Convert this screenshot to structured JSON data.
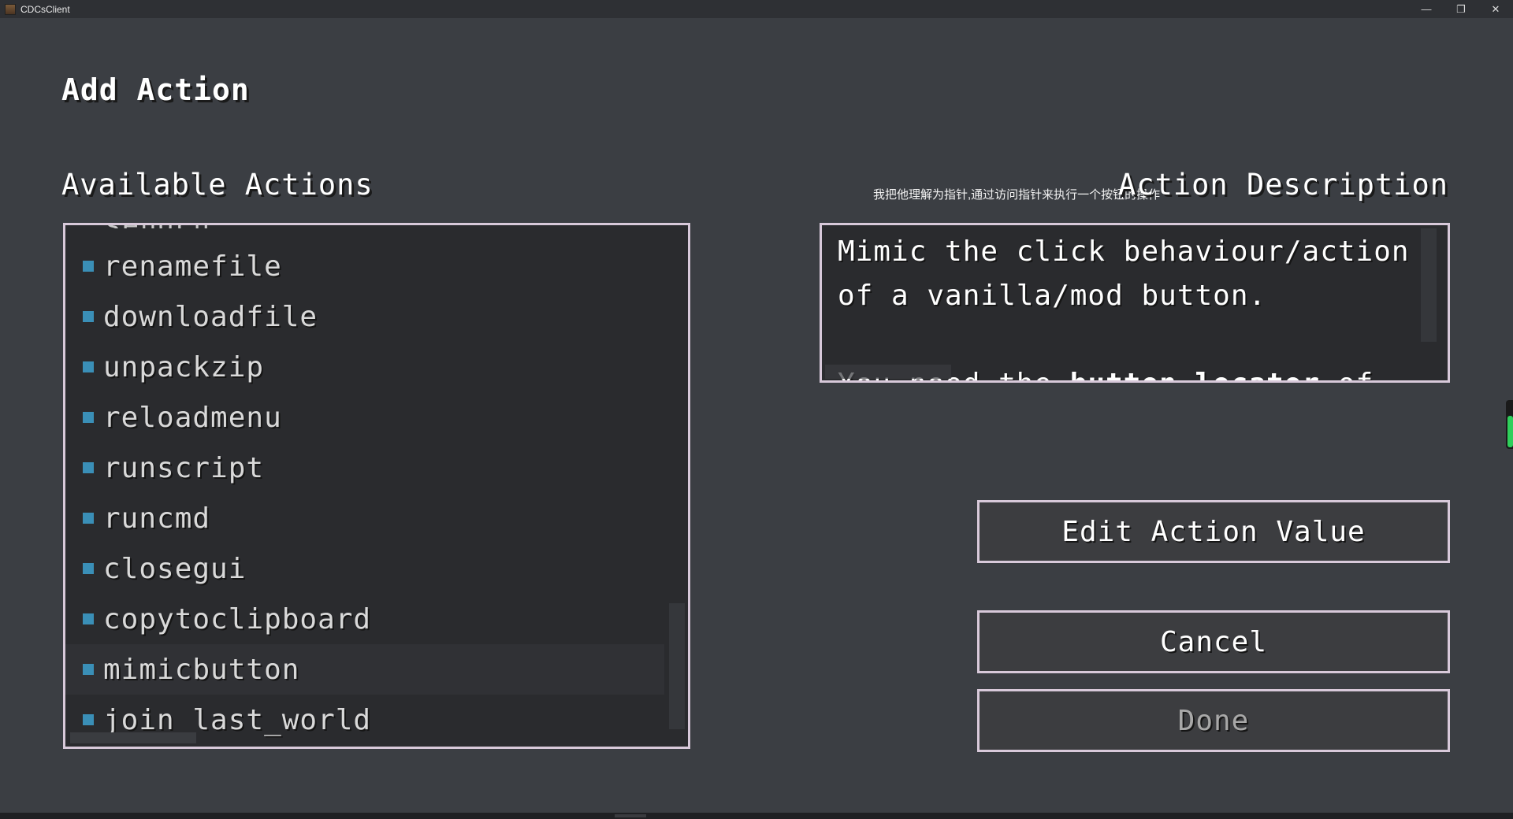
{
  "window": {
    "title": "CDCsClient",
    "minimize_glyph": "—",
    "restore_glyph": "❐",
    "close_glyph": "✕"
  },
  "page": {
    "title": "Add Action"
  },
  "annotation": "我把他理解为指针,通过访问指针来执行一个按钮的操作",
  "available_actions": {
    "heading": "Available Actions",
    "clipped_item": "sendchat",
    "items": [
      {
        "label": "renamefile"
      },
      {
        "label": "downloadfile"
      },
      {
        "label": "unpackzip"
      },
      {
        "label": "reloadmenu"
      },
      {
        "label": "runscript"
      },
      {
        "label": "runcmd"
      },
      {
        "label": "closegui"
      },
      {
        "label": "copytoclipboard"
      },
      {
        "label": "mimicbutton",
        "state": "hovered"
      },
      {
        "label": "join_last_world"
      }
    ],
    "bullet_color": "#3a8fb7"
  },
  "action_description": {
    "heading": "Action Description",
    "line1": "Mimic the click behaviour/action",
    "line2": "of a vanilla/mod button.",
    "line3_prefix": "You need the ",
    "line3_bold": "button locator",
    "line3_suffix": " of"
  },
  "buttons": {
    "edit_action_value": "Edit Action Value",
    "cancel": "Cancel",
    "done": "Done"
  },
  "colors": {
    "background": "#3b3e43",
    "panel": "#2a2b2e",
    "border": "#d8c9da",
    "indicator": "#2fcf5b"
  }
}
